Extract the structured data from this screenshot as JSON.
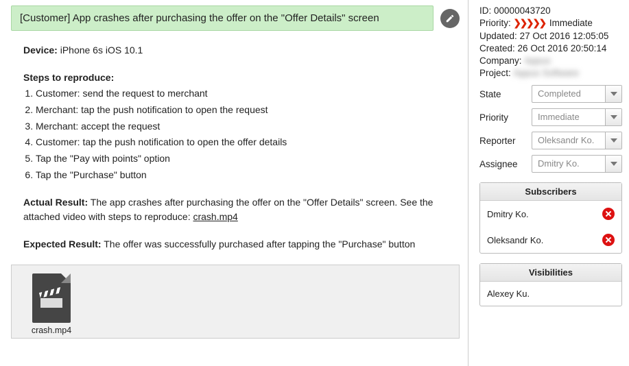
{
  "title": "[Customer] App crashes after purchasing the offer on the \"Offer Details\" screen",
  "device_label": "Device:",
  "device_value": "iPhone 6s iOS 10.1",
  "steps_label": "Steps to reproduce:",
  "steps": [
    "Customer: send the request to merchant",
    "Merchant: tap the push notification to open the request",
    "Merchant: accept the request",
    "Customer: tap the push notification to open the offer details",
    "Tap the \"Pay with points\" option",
    "Tap the \"Purchase\" button"
  ],
  "actual_label": "Actual Result:",
  "actual_value": "The app crashes after purchasing the offer on the \"Offer Details\" screen. See the attached video with steps to reproduce: ",
  "actual_link": "crash.mp4",
  "expected_label": "Expected Result:",
  "expected_value": "The offer was successfully purchased after tapping the \"Purchase\" button",
  "attachment_name": "crash.mp4",
  "meta": {
    "id_label": "ID:",
    "id": "00000043720",
    "priority_label": "Priority:",
    "priority_text": "Immediate",
    "updated_label": "Updated:",
    "updated": "27 Oct 2016 12:05:05",
    "created_label": "Created:",
    "created": "26 Oct 2016 20:50:14",
    "company_label": "Company:",
    "company": "Appus",
    "project_label": "Project:",
    "project": "Appus Software"
  },
  "fields": {
    "state_label": "State",
    "state_value": "Completed",
    "priority_label": "Priority",
    "priority_value": "Immediate",
    "reporter_label": "Reporter",
    "reporter_value": "Oleksandr Ko.",
    "assignee_label": "Assignee",
    "assignee_value": "Dmitry Ko."
  },
  "subscribers": {
    "heading": "Subscribers",
    "items": [
      "Dmitry Ko.",
      "Oleksandr Ko."
    ]
  },
  "visibilities": {
    "heading": "Visibilities",
    "items": [
      "Alexey Ku."
    ]
  }
}
